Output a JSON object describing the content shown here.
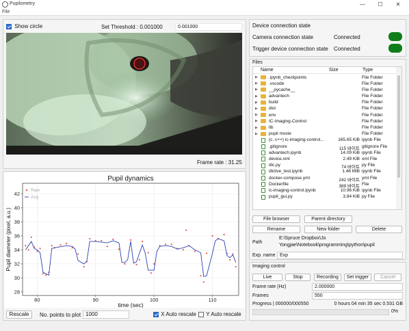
{
  "window": {
    "title": "Pupilometry",
    "menu_file": "File"
  },
  "camera": {
    "show_circle_label": "Show circle",
    "show_circle_checked": true,
    "threshold_label": "Set Threshold : 0.001000",
    "threshold_value": "0.001000",
    "frame_rate_label": "Frame rate : 31.25"
  },
  "plot": {
    "bottom": {
      "rescale_label": "Rescale",
      "npoints_label": "No. points to plot",
      "npoints_value": "1000",
      "x_auto_label": "X Auto rescale",
      "y_auto_label": "Y Auto rescale"
    }
  },
  "chart_data": {
    "type": "line",
    "title": "Pupil dynamics",
    "xlabel": "time (sec)",
    "ylabel": "Pupil diameter (pixel, a.u.)",
    "xlim": [
      77.5,
      114.5
    ],
    "ylim": [
      27.5,
      43.5
    ],
    "xticks": [
      80,
      90,
      100,
      110
    ],
    "yticks": [
      28,
      30,
      32,
      34,
      36,
      38,
      40,
      42
    ],
    "grid": true,
    "legend": [
      "Raw",
      "Avg"
    ],
    "legend_position": "top-left",
    "series": [
      {
        "name": "Raw",
        "style": "scatter",
        "color": "#e0554a",
        "x": [
          78,
          78.5,
          79,
          79.5,
          80,
          80.5,
          81,
          81.5,
          82,
          82.5,
          83,
          84,
          85,
          86,
          87,
          88,
          88.5,
          89,
          90,
          91,
          92,
          93,
          94,
          95,
          96,
          97,
          97.5,
          98,
          99,
          99.5,
          100,
          101,
          102,
          103,
          104,
          105,
          105.5,
          106,
          107,
          108,
          108.5,
          109,
          110,
          111,
          112,
          112.5,
          113,
          113.5,
          114
        ],
        "y": [
          34.6,
          34.0,
          35.8,
          34.4,
          33.8,
          34.2,
          30.6,
          30.4,
          30.8,
          34.6,
          34.3,
          34.7,
          34.9,
          34.3,
          33.4,
          31.6,
          32.3,
          35.6,
          35.3,
          35.3,
          34.5,
          35.5,
          34.1,
          32.0,
          35.4,
          31.9,
          32.6,
          35.2,
          33.6,
          30.7,
          32.0,
          34.6,
          34.8,
          34.8,
          34.2,
          34.0,
          36.8,
          34.6,
          33.8,
          30.3,
          29.4,
          33.5,
          36.0,
          35.6,
          36.2,
          33.5,
          32.6,
          33.4,
          31.6
        ]
      },
      {
        "name": "Avg",
        "style": "line",
        "color": "#2a3fb3",
        "x": [
          78,
          79,
          79.5,
          80,
          80.5,
          81,
          82,
          82.5,
          83,
          85,
          86,
          86.5,
          87,
          88,
          88.5,
          89,
          90,
          92,
          93,
          94,
          94.5,
          95,
          95.5,
          96,
          96.5,
          97,
          98,
          98.5,
          99,
          100,
          100.5,
          101,
          102,
          103,
          104,
          105,
          106,
          107,
          108,
          108.5,
          109,
          110,
          110.5,
          111,
          112,
          112.5,
          113,
          113.5,
          114
        ],
        "y": [
          34.0,
          35.2,
          34.2,
          34.0,
          33.6,
          30.8,
          30.4,
          34.2,
          34.3,
          34.6,
          34.5,
          34.1,
          32.5,
          32.0,
          32.4,
          35.2,
          35.2,
          35.0,
          35.3,
          35.0,
          32.2,
          32.2,
          32.6,
          35.2,
          32.1,
          32.3,
          34.7,
          33.5,
          31.1,
          31.1,
          33.8,
          34.5,
          34.6,
          34.5,
          34.1,
          34.3,
          34.6,
          34.0,
          33.6,
          30.2,
          30.3,
          33.5,
          35.3,
          35.6,
          35.3,
          33.2,
          32.9,
          33.3,
          32.2
        ]
      }
    ]
  },
  "device": {
    "title": "Device connection state",
    "camera_label": "Camera connection state",
    "camera_status": "Connected",
    "trigger_label": "Trigger device connection state",
    "trigger_status": "Connected",
    "status_color": "#0f7d1a"
  },
  "files": {
    "title": "Files",
    "headers": {
      "name": "Name",
      "size": "Size",
      "type": "Type"
    },
    "rows": [
      {
        "name": ".ipynb_checkpoints",
        "size": "",
        "type": "File Folder",
        "kind": "folder"
      },
      {
        "name": ".vscode",
        "size": "",
        "type": "File Folder",
        "kind": "folder"
      },
      {
        "name": "__pycache__",
        "size": "",
        "type": "File Folder",
        "kind": "folder"
      },
      {
        "name": "advantech",
        "size": "",
        "type": "File Folder",
        "kind": "folder"
      },
      {
        "name": "build",
        "size": "",
        "type": "File Folder",
        "kind": "folder"
      },
      {
        "name": "dist",
        "size": "",
        "type": "File Folder",
        "kind": "folder"
      },
      {
        "name": "env",
        "size": "",
        "type": "File Folder",
        "kind": "folder"
      },
      {
        "name": "IC-Imaging-Control",
        "size": "",
        "type": "File Folder",
        "kind": "folder"
      },
      {
        "name": "lib",
        "size": "",
        "type": "File Folder",
        "kind": "folder"
      },
      {
        "name": "pupil movie",
        "size": "",
        "type": "File Folder",
        "kind": "folder"
      },
      {
        "name": "(c. c++) ic-imaging-control...",
        "size": "165.65 KiB",
        "type": "ipynb File",
        "kind": "file"
      },
      {
        "name": ".gitignore",
        "size": "115 바이트",
        "type": "gitignore File",
        "kind": "file"
      },
      {
        "name": "advantech.ipynb",
        "size": "14.09 KiB",
        "type": "ipynb File",
        "kind": "file"
      },
      {
        "name": "device.xml",
        "size": "2.49 KiB",
        "type": "xml File",
        "kind": "file"
      },
      {
        "name": "dlc.py",
        "size": "74 바이트",
        "type": "py File",
        "kind": "file"
      },
      {
        "name": "dlclive_test.ipynb",
        "size": "1.46 MiB",
        "type": "ipynb File",
        "kind": "file"
      },
      {
        "name": "docker-compose.yml",
        "size": "242 바이트",
        "type": "yml File",
        "kind": "file"
      },
      {
        "name": "Dockerfile",
        "size": "389 바이트",
        "type": "File",
        "kind": "file"
      },
      {
        "name": "ic-imaging-control.ipynb",
        "size": "10.96 KiB",
        "type": "ipynb File",
        "kind": "file"
      },
      {
        "name": "pupil_gui.py",
        "size": "3.84 KiB",
        "type": "py File",
        "kind": "file"
      }
    ],
    "buttons": {
      "browser": "File browser",
      "parent": "Parent directory",
      "rename": "Rename",
      "new_folder": "New folder",
      "delete": "Delete"
    },
    "path_label": "Path",
    "path_value_line1": "E:\\Spruce Dropbox\\Jo",
    "path_value_line2": "Yongjae\\Notebook\\programming\\python\\pupil",
    "exp_label": "Exp. name",
    "exp_value": "Exp"
  },
  "imaging": {
    "title": "Imaging control",
    "live": "Live",
    "stop": "Stop",
    "recording": "Recording",
    "set_trigger": "Set trigger",
    "cancel": "Cancel",
    "frame_rate_label": "Frame rate (Hz)",
    "frame_rate_value": "2.000000",
    "frames_label": "Frames",
    "frames_value": "550",
    "progress_label": "Progress | 000000/000550",
    "progress_time": "0 hours 04 min 35 sec 0.531 GB",
    "progress_pct": "0%",
    "progress_fraction": 0
  }
}
